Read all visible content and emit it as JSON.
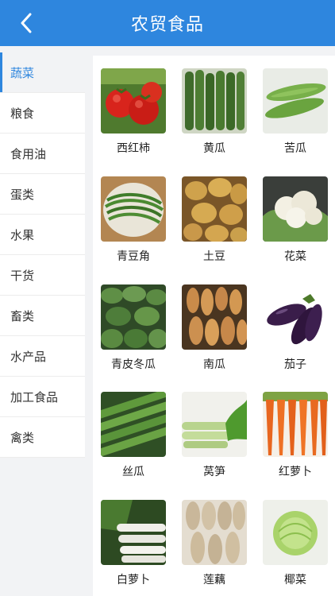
{
  "header": {
    "title": "农贸食品"
  },
  "sidebar": {
    "items": [
      {
        "label": "蔬菜",
        "active": true
      },
      {
        "label": "粮食"
      },
      {
        "label": "食用油"
      },
      {
        "label": "蛋类"
      },
      {
        "label": "水果"
      },
      {
        "label": "干货"
      },
      {
        "label": "畜类"
      },
      {
        "label": "水产品"
      },
      {
        "label": "加工食品"
      },
      {
        "label": "禽类"
      }
    ]
  },
  "products": {
    "items": [
      {
        "label": "西红柿",
        "icon": "tomato-image"
      },
      {
        "label": "黄瓜",
        "icon": "cucumber-image"
      },
      {
        "label": "苦瓜",
        "icon": "bitter-melon-image"
      },
      {
        "label": "青豆角",
        "icon": "long-bean-image"
      },
      {
        "label": "土豆",
        "icon": "potato-image"
      },
      {
        "label": "花菜",
        "icon": "cauliflower-image"
      },
      {
        "label": "青皮冬瓜",
        "icon": "winter-melon-image"
      },
      {
        "label": "南瓜",
        "icon": "pumpkin-image"
      },
      {
        "label": "茄子",
        "icon": "eggplant-image"
      },
      {
        "label": "丝瓜",
        "icon": "loofah-image"
      },
      {
        "label": "莴笋",
        "icon": "celtuce-image"
      },
      {
        "label": "红萝卜",
        "icon": "carrot-image"
      },
      {
        "label": "白萝卜",
        "icon": "white-radish-image"
      },
      {
        "label": "莲藕",
        "icon": "lotus-root-image"
      },
      {
        "label": "椰菜",
        "icon": "cabbage-image"
      }
    ]
  },
  "colors": {
    "accent": "#2e86de",
    "background": "#f2f3f5"
  }
}
